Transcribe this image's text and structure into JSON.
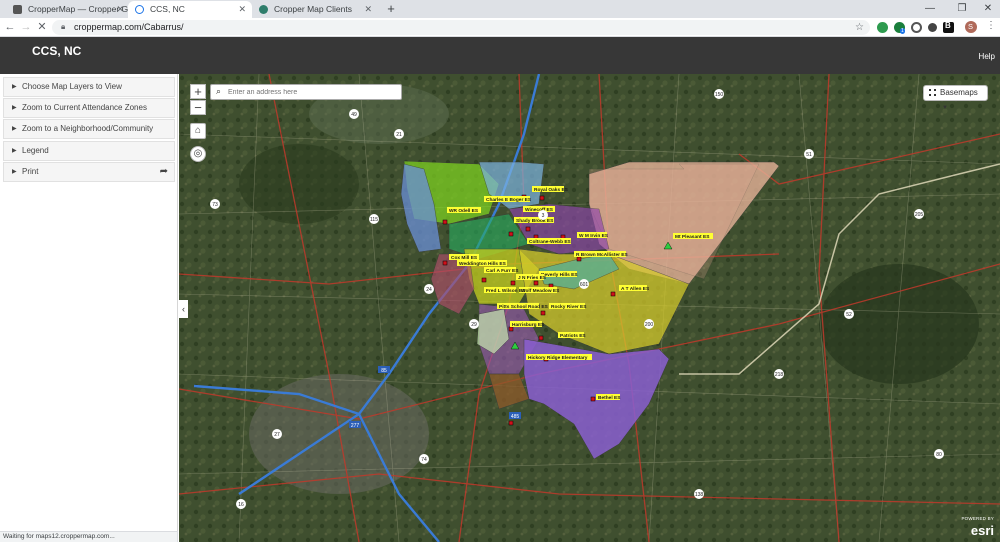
{
  "browser": {
    "tabs": [
      {
        "title": "CropperMap — Cropper GIS",
        "active": false
      },
      {
        "title": "CCS, NC",
        "active": true
      },
      {
        "title": "Cropper Map Clients",
        "active": false
      }
    ],
    "url": "croppermap.com/Cabarrus/",
    "profile_initial": "S",
    "ext_badge": "1"
  },
  "app": {
    "title": "CCS, NC",
    "help_label": "Help"
  },
  "sidebar": {
    "items": [
      {
        "label": "Choose Map Layers to View"
      },
      {
        "label": "Zoom to Current Attendance Zones"
      },
      {
        "label": "Zoom to a Neighborhood/Community"
      },
      {
        "label": "Legend"
      },
      {
        "label": "Print"
      }
    ]
  },
  "map": {
    "search_placeholder": "Enter an address here",
    "basemaps_label": "Basemaps",
    "esri_powered": "POWERED BY",
    "esri_label": "esri",
    "school_labels": [
      "Royal Oaks ES",
      "Charles E Boger ES",
      "WR Odell ES",
      "Winecoff ES",
      "Shady Brook ES",
      "Coltrane-Webb ES",
      "W M Irvin ES",
      "Mt Pleasant ES",
      "A T Allen ES",
      "Carl A Furr ES",
      "Harrisburg ES",
      "Patriots ES",
      "Hickory Ridge Elementary",
      "Bethel ES",
      "Pitts School Road ES",
      "Rocky River ES",
      "Weddington Hills ES",
      "Cox Mill ES",
      "R Brown McAllister ES",
      "Beverly Hills ES",
      "J N Fries ES",
      "Wolf Meadow ES",
      "Fred L Wilson ES"
    ],
    "route_shields": [
      "73",
      "49",
      "85",
      "24",
      "601",
      "200",
      "3",
      "29",
      "27",
      "52",
      "485",
      "277",
      "74",
      "16",
      "21",
      "115",
      "150",
      "218",
      "205",
      "138",
      "80",
      "51"
    ]
  },
  "status_bar": "Waiting for maps12.croppermap.com...",
  "colors": {
    "header": "#373737",
    "tabstrip": "#dee1e6",
    "accent": "#1a73e8"
  }
}
